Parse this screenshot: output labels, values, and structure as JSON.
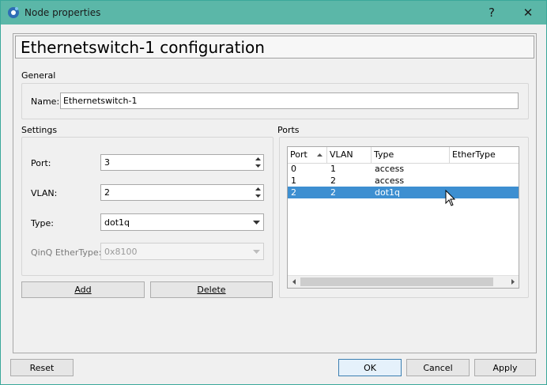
{
  "window": {
    "title": "Node properties",
    "help_glyph": "?",
    "close_glyph": "✕",
    "accent": "#5bb7a8"
  },
  "header": {
    "title": "Ethernetswitch-1 configuration"
  },
  "general": {
    "group_label": "General",
    "name_label": "Name:",
    "name_value": "Ethernetswitch-1"
  },
  "settings": {
    "group_label": "Settings",
    "port_label": "Port:",
    "port_value": "3",
    "vlan_label": "VLAN:",
    "vlan_value": "2",
    "type_label": "Type:",
    "type_value": "dot1q",
    "qinq_label": "QinQ EtherType:",
    "qinq_value": "0x8100",
    "add_label": "Add",
    "delete_label": "Delete"
  },
  "ports": {
    "group_label": "Ports",
    "columns": [
      "Port",
      "VLAN",
      "Type",
      "EtherType"
    ],
    "rows": [
      {
        "port": "0",
        "vlan": "1",
        "type": "access",
        "ethertype": ""
      },
      {
        "port": "1",
        "vlan": "2",
        "type": "access",
        "ethertype": ""
      },
      {
        "port": "2",
        "vlan": "2",
        "type": "dot1q",
        "ethertype": ""
      }
    ],
    "selected_row": 2,
    "selection_color": "#3d8fd1"
  },
  "footer": {
    "reset_label": "Reset",
    "ok_label": "OK",
    "cancel_label": "Cancel",
    "apply_label": "Apply"
  }
}
